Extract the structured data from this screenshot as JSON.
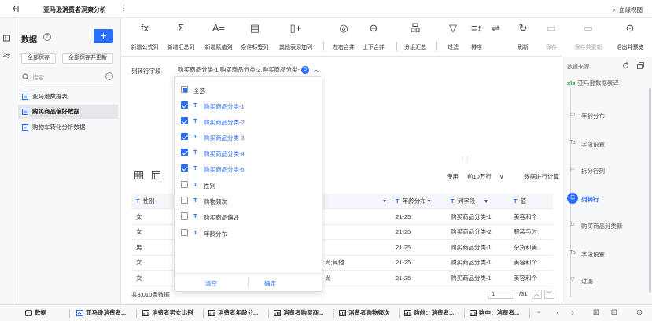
{
  "app": {
    "title": "亚马逊消费者洞察分析",
    "lineage": "血缘视图"
  },
  "left": {
    "header": "数据",
    "add": "+",
    "save_all": "全部保存",
    "save_all_update": "全部保存并更新",
    "search_placeholder": "搜索",
    "tables": [
      "亚马逊数据表",
      "购买商品偏好数据",
      "购物车转化分析数据"
    ]
  },
  "toolbar": {
    "items": [
      {
        "icon": "fx",
        "label": "新增公式列"
      },
      {
        "icon": "Σ",
        "label": "新增汇总列"
      },
      {
        "icon": "A=",
        "label": "新增赋值列"
      },
      {
        "icon": "▤",
        "label": "条件标签列"
      },
      {
        "icon": "▯+",
        "label": "其他表添加列"
      },
      {
        "icon": "◎",
        "label": "左右合并"
      },
      {
        "icon": "⊖",
        "label": "上下合并"
      },
      {
        "icon": "品",
        "label": "分组汇总"
      },
      {
        "icon": "▽",
        "label": "过滤"
      },
      {
        "icon": "≡↕",
        "label": "排序"
      },
      {
        "icon": "⇌",
        "label": "⇌"
      },
      {
        "icon": "↻",
        "label": "刷新"
      },
      {
        "icon": "▭",
        "label": "保存"
      },
      {
        "icon": "▭",
        "label": "保存并更新"
      },
      {
        "icon": "⊙",
        "label": "退出并预览"
      }
    ]
  },
  "section": {
    "row_label": "列转行字段",
    "selected_fields": "购买商品分类-1,购买商品分类-2,购买商品分类-",
    "selected_count": "5",
    "use_label": "使用",
    "rows_option": "前10万行",
    "calc_label": "数据进行计算",
    "total": "共3,010条数据",
    "page_input": "1",
    "page_total": "/31"
  },
  "dropdown": {
    "select_all": "全选",
    "options": [
      {
        "label": "购买商品分类-1",
        "checked": true
      },
      {
        "label": "购买商品分类-2",
        "checked": true
      },
      {
        "label": "购买商品分类-3",
        "checked": true
      },
      {
        "label": "购买商品分类-4",
        "checked": true
      },
      {
        "label": "购买商品分类-5",
        "checked": true
      },
      {
        "label": "性别",
        "checked": false
      },
      {
        "label": "购物频次",
        "checked": false
      },
      {
        "label": "购买商品偏好",
        "checked": false
      },
      {
        "label": "年龄分布",
        "checked": false
      }
    ],
    "clear": "清空",
    "ok": "确定"
  },
  "table": {
    "headers": [
      "性别",
      "",
      "年龄分布",
      "列字段",
      "值"
    ],
    "rows": [
      [
        "女",
        "",
        "21-25",
        "购买商品分类-1",
        "美容和个"
      ],
      [
        "女",
        "",
        "21-25",
        "购买商品分类-2",
        "服装与时"
      ],
      [
        "男",
        "",
        "21-25",
        "购买商品分类-1",
        "杂货和美"
      ],
      [
        "女",
        "尚;其他",
        "21-25",
        "购买商品分类-1",
        "美容和个"
      ],
      [
        "女",
        "尚",
        "21-25",
        "购买商品分类-1",
        "美容和个"
      ]
    ]
  },
  "right": {
    "source_label": "数据来源",
    "source_file": "亚马逊数据表译",
    "steps": [
      {
        "label": "年龄分布",
        "icon": "▭"
      },
      {
        "label": "字段设置",
        "icon": "To"
      },
      {
        "label": "拆分行列",
        "icon": "⊨"
      },
      {
        "label": "列转行",
        "icon": "⊟"
      },
      {
        "label": "购买商品分类新",
        "icon": "fx"
      },
      {
        "label": "字段设置",
        "icon": "To"
      },
      {
        "label": "过滤",
        "icon": "▽"
      }
    ]
  },
  "bottom": {
    "data_tab": "数据",
    "tabs": [
      "亚马逊消费者...",
      "消费者男女比例",
      "消费者年龄分...",
      "消费者购买商...",
      "消费者购物频次",
      "购前：消费者...",
      "购中：消费者..."
    ]
  }
}
